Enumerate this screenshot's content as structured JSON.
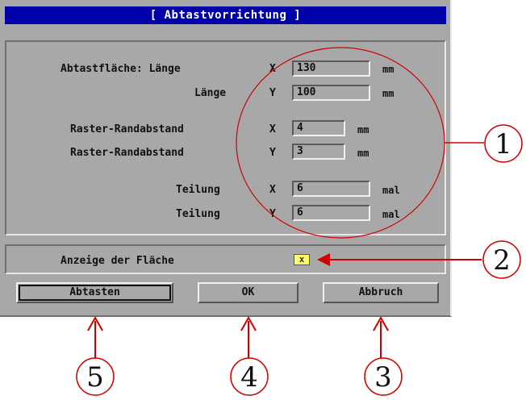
{
  "dialog": {
    "title": "[ Abtastvorrichtung ]",
    "rows": [
      {
        "label": "Abtastfläche: Länge",
        "axis": "X",
        "value": "130",
        "unit": "mm"
      },
      {
        "label": "Länge",
        "axis": "Y",
        "value": "100",
        "unit": "mm"
      },
      {
        "label": "Raster-Randabstand",
        "axis": "X",
        "value": "4",
        "unit": "mm"
      },
      {
        "label": "Raster-Randabstand",
        "axis": "Y",
        "value": "3",
        "unit": "mm"
      },
      {
        "label": "Teilung",
        "axis": "X",
        "value": "6",
        "unit": "mal"
      },
      {
        "label": "Teilung",
        "axis": "Y",
        "value": "6",
        "unit": "mal"
      }
    ],
    "display_area": {
      "label": "Anzeige der Fläche",
      "checked_mark": "x"
    },
    "buttons": {
      "scan": "Abtasten",
      "ok": "OK",
      "cancel": "Abbruch"
    }
  },
  "annotations": {
    "callouts": [
      "1",
      "2",
      "3",
      "4",
      "5"
    ],
    "color": "#d00000"
  },
  "colors": {
    "title_bg": "#0000a8",
    "dialog_bg": "#a8a8a8",
    "checkbox_bg": "#ffff66"
  }
}
